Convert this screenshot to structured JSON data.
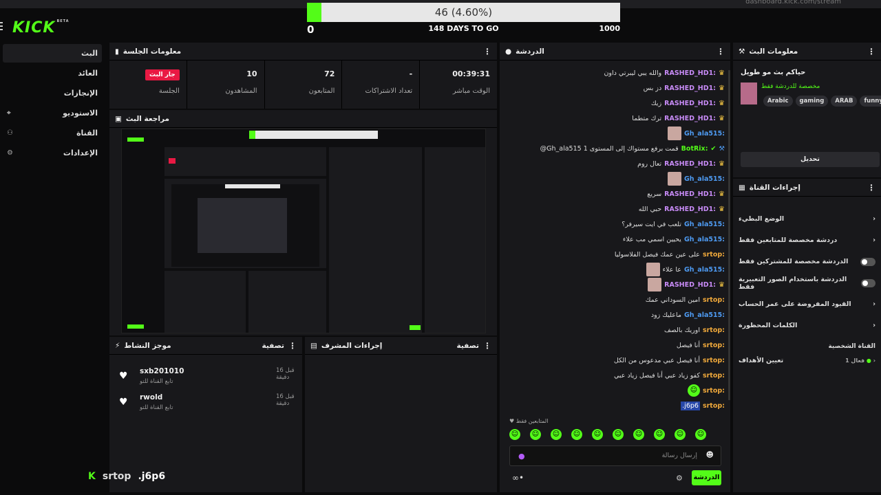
{
  "browser": {
    "url": "dashboard.kick.com/stream"
  },
  "brand": {
    "logo": "KICK",
    "beta": "BETA",
    "accent": "#53fc18"
  },
  "goal": {
    "label": "46 (4.60%)",
    "progress": 0.046,
    "min": "0",
    "max": "1000",
    "days_left": "148 DAYS TO GO"
  },
  "sidebar": {
    "items": [
      {
        "label": "البث",
        "icon": ""
      },
      {
        "label": "العائد",
        "icon": ""
      },
      {
        "label": "الإنجازات",
        "icon": ""
      },
      {
        "label": "الاستوديو",
        "icon": "⌖"
      },
      {
        "label": "القناة",
        "icon": "⚇"
      },
      {
        "label": "الإعدادات",
        "icon": "⚙"
      }
    ]
  },
  "session": {
    "title": "معلومات الجلسة",
    "stats": [
      {
        "value": "00:39:31",
        "label": "الوقت مباشر"
      },
      {
        "value": "-",
        "label": "تعداد الاشتراكات"
      },
      {
        "value": "72",
        "label": "المتابعون"
      },
      {
        "value": "10",
        "label": "المشاهدون"
      },
      {
        "value": "جار البث",
        "label": "الجلسة"
      }
    ]
  },
  "preview": {
    "title": "مراجعة البث"
  },
  "activity": {
    "title": "موجز النشاط",
    "filter": "تصفية",
    "items": [
      {
        "name": "sxb201010",
        "desc": "تابع القناة للتو",
        "ago": "قبل 16 دقيقة"
      },
      {
        "name": "rwold",
        "desc": "تابع القناة للتو",
        "ago": "قبل 16 دقيقة"
      }
    ]
  },
  "moderator": {
    "title": "إجراءات المشرف",
    "filter": "تصفية"
  },
  "chat": {
    "title": "الدردشة",
    "messages": [
      {
        "user": "RASHED_HD1",
        "text": "والله يبي ليبرتي داون",
        "badge": "crown",
        "color": "#c88bf7"
      },
      {
        "user": "RASHED_HD1",
        "text": "دز بس",
        "badge": "crown",
        "color": "#c88bf7"
      },
      {
        "user": "RASHED_HD1",
        "text": "زيك",
        "badge": "crown",
        "color": "#c88bf7"
      },
      {
        "user": "RASHED_HD1",
        "text": "ترك متطما",
        "badge": "crown",
        "color": "#c88bf7"
      },
      {
        "user": "Gh_ala515",
        "text": "",
        "badge": "",
        "color": "#4e9bf3",
        "avatar": true
      },
      {
        "user": "BotRix",
        "text": "@Gh_ala515 قمت برفع مستواك إلى المستوى 1",
        "badge": "bot",
        "color": "#53fc18"
      },
      {
        "user": "RASHED_HD1",
        "text": "تعال روم",
        "badge": "crown",
        "color": "#c88bf7"
      },
      {
        "user": "Gh_ala515",
        "text": "",
        "badge": "",
        "color": "#4e9bf3",
        "avatar": true
      },
      {
        "user": "RASHED_HD1",
        "text": "سريع",
        "badge": "crown",
        "color": "#c88bf7"
      },
      {
        "user": "RASHED_HD1",
        "text": "حبي الله",
        "badge": "crown",
        "color": "#c88bf7"
      },
      {
        "user": "Gh_ala515",
        "text": "تلعب في ايت سيرفر؟",
        "badge": "",
        "color": "#4e9bf3"
      },
      {
        "user": "Gh_ala515",
        "text": "يحيين اسمي مب علاء",
        "badge": "",
        "color": "#4e9bf3"
      },
      {
        "user": "srtop",
        "text": "على عين عمك فيصل الفلاسوليا",
        "badge": "",
        "color": "#f0a93b"
      },
      {
        "user": "Gh_ala515",
        "text": "عا علاء",
        "badge": "",
        "color": "#4e9bf3",
        "avatar": true
      },
      {
        "user": "RASHED_HD1",
        "text": "",
        "badge": "crown",
        "color": "#c88bf7",
        "avatar": true
      },
      {
        "user": "srtop",
        "text": "امين السوداني عمك",
        "badge": "",
        "color": "#f0a93b"
      },
      {
        "user": "Gh_ala515",
        "text": "ماعليك زود",
        "badge": "",
        "color": "#4e9bf3"
      },
      {
        "user": "srtop",
        "text": "اوريك بالصف",
        "badge": "",
        "color": "#f0a93b"
      },
      {
        "user": "srtop",
        "text": "أنا فيصل",
        "badge": "",
        "color": "#f0a93b"
      },
      {
        "user": "srtop",
        "text": "أنا فيصل عبي مدعوس من الكل",
        "badge": "",
        "color": "#f0a93b"
      },
      {
        "user": "srtop",
        "text": "كفو زياد عبي أنا فيصل زياد عبي",
        "badge": "",
        "color": "#f0a93b"
      },
      {
        "user": "srtop",
        "text": "",
        "badge": "",
        "color": "#f0a93b",
        "emote": true
      },
      {
        "user": "srtop",
        "text": ".j6p6",
        "badge": "",
        "color": "#f0a93b",
        "highlight": true
      }
    ],
    "followers_only": "المتابعين فقط",
    "input_placeholder": "إرسال رسالة",
    "send_label": "الدردشة"
  },
  "stream_info": {
    "title": "معلومات البث",
    "stream_title": "حياكم بث مو طويل",
    "category_note": "مخصصة للدردشة فقط",
    "tags": [
      "Arabic",
      "gaming",
      "ARAB",
      "funny"
    ],
    "edit_label": "تحديل"
  },
  "channel_actions": {
    "title": "إجراءات القناة",
    "rows": [
      {
        "label": "الوضع البطيء",
        "control": "chevron"
      },
      {
        "label": "دردشة مخصصة للمتابعين فقط",
        "control": "chevron"
      },
      {
        "label": "الدردشة مخصصة للمشتركين فقط",
        "control": "toggle"
      },
      {
        "label": "الدردشة باستخدام الصور التعبيرية فقط",
        "control": "toggle"
      },
      {
        "label": "القيود المفروضة على عمر الحساب",
        "control": "chevron"
      },
      {
        "label": "الكلمات المحظورة",
        "control": "chevron"
      }
    ],
    "private_section": "القناة الشخصية",
    "goals_label": "تعيين الأهداف",
    "goals_status": "فعال 1"
  },
  "overlay": {
    "user": "srtop",
    "text": ".j6p6"
  }
}
